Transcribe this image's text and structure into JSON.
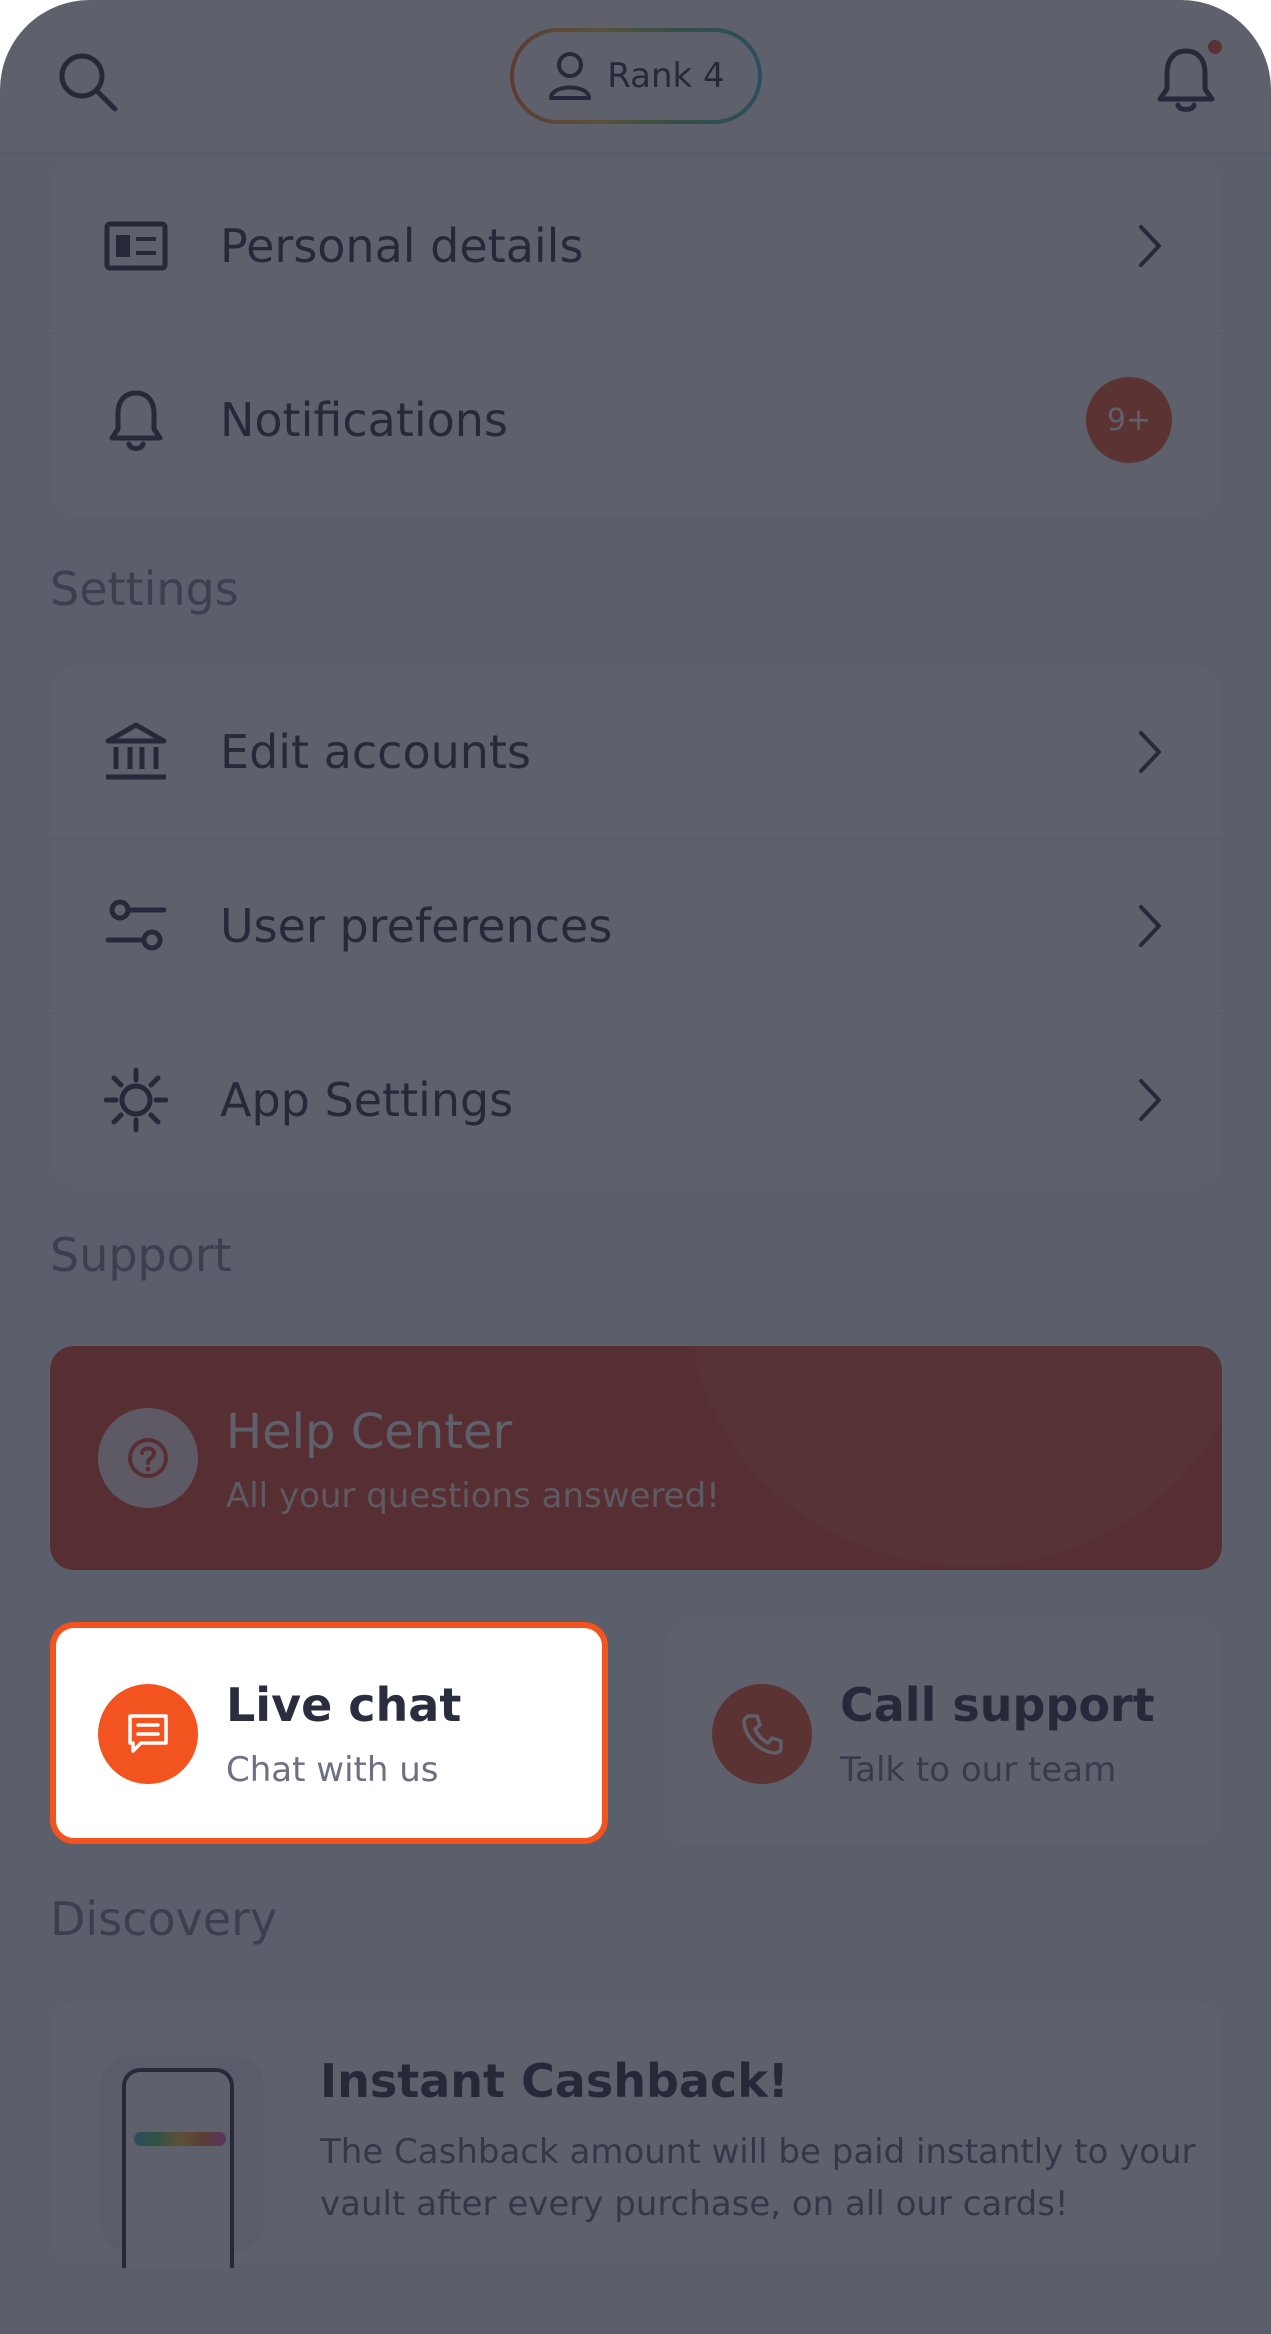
{
  "header": {
    "rank_label": "Rank 4",
    "search_icon": "search-icon",
    "notification_icon": "bell-icon",
    "rank_icon": "user-icon"
  },
  "account_items": [
    {
      "label": "Personal details",
      "icon": "id-card-icon"
    },
    {
      "label": "Notifications",
      "icon": "bell-icon",
      "badge": "9+"
    }
  ],
  "settings": {
    "title": "Settings",
    "items": [
      {
        "label": "Edit accounts",
        "icon": "bank-icon"
      },
      {
        "label": "User preferences",
        "icon": "sliders-icon"
      },
      {
        "label": "App Settings",
        "icon": "gear-icon"
      }
    ]
  },
  "support": {
    "title": "Support",
    "help_center": {
      "title": "Help Center",
      "subtitle": "All your questions answered!",
      "icon": "question-icon"
    },
    "live_chat": {
      "title": "Live chat",
      "subtitle": "Chat with us",
      "icon": "chat-icon"
    },
    "call_support": {
      "title": "Call support",
      "subtitle": "Talk to our team",
      "icon": "phone-icon"
    }
  },
  "discovery": {
    "title": "Discovery",
    "card": {
      "title": "Instant Cashback!",
      "text": "The Cashback amount will be paid instantly to your vault after every purchase, on all our cards!"
    }
  },
  "colors": {
    "accent": "#f3531f",
    "overlay": "#262838",
    "background": "#f4f5fa"
  }
}
